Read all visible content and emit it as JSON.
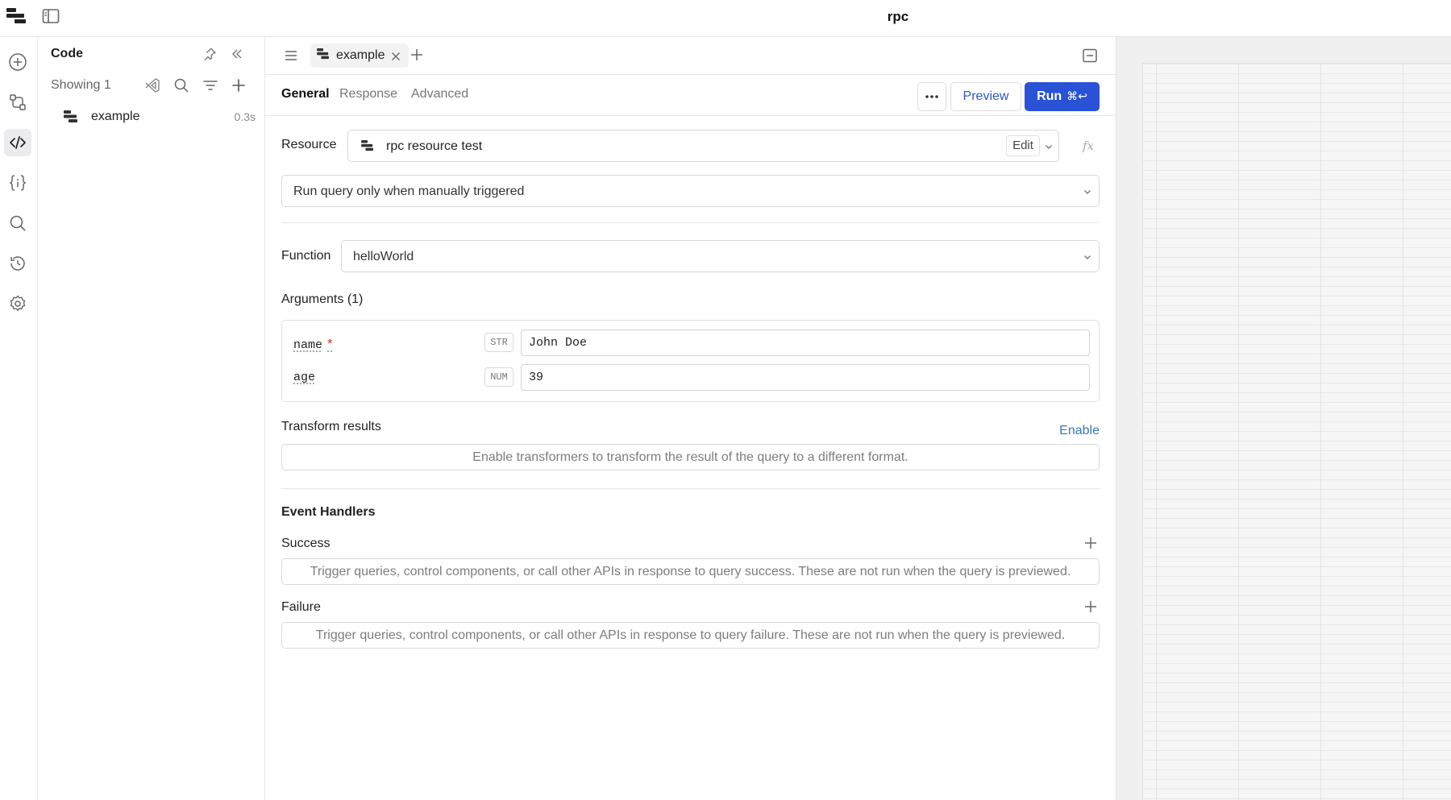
{
  "app": {
    "title": "rpc"
  },
  "sidebar": {
    "title": "Code",
    "showing": "Showing 1",
    "items": [
      {
        "name": "example",
        "time": "0.3s"
      }
    ]
  },
  "editor": {
    "tab": {
      "label": "example"
    },
    "subtabs": [
      "General",
      "Response",
      "Advanced"
    ],
    "actions": {
      "preview": "Preview",
      "run": "Run",
      "run_shortcut": "⌘↩"
    },
    "resource": {
      "label": "Resource",
      "value": "rpc resource test",
      "edit": "Edit",
      "fx": "fx"
    },
    "trigger": {
      "value": "Run query only when manually triggered"
    },
    "function": {
      "label": "Function",
      "value": "helloWorld"
    },
    "arguments": {
      "heading": "Arguments (1)",
      "items": [
        {
          "name": "name",
          "required": "*",
          "type": "STR",
          "value": "John Doe"
        },
        {
          "name": "age",
          "type": "NUM",
          "value": "39"
        }
      ]
    },
    "transform": {
      "heading": "Transform results",
      "enable": "Enable",
      "hint": "Enable transformers to transform the result of the query to a different format."
    },
    "event_handlers": {
      "heading": "Event Handlers",
      "success": {
        "label": "Success",
        "hint": "Trigger queries, control components, or call other APIs in response to query success. These are not run when the query is previewed."
      },
      "failure": {
        "label": "Failure",
        "hint": "Trigger queries, control components, or call other APIs in response to query failure. These are not run when the query is previewed."
      }
    }
  },
  "colors": {
    "accent": "#2952d6",
    "link": "#3777c6",
    "required": "#c8362d"
  }
}
